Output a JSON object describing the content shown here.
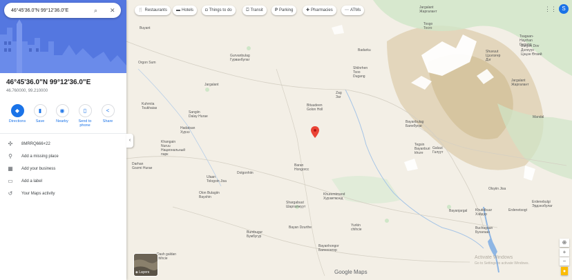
{
  "search": {
    "value": "46°45'36.0\"N 99°12'36.0\"E"
  },
  "place": {
    "title": "46°45'36.0\"N 99°12'36.0\"E",
    "coordinates": "46.760000, 99.210000"
  },
  "actions": [
    {
      "label": "Directions",
      "icon": "directions-icon"
    },
    {
      "label": "Save",
      "icon": "bookmark-icon"
    },
    {
      "label": "Nearby",
      "icon": "nearby-icon"
    },
    {
      "label": "Send to phone",
      "icon": "phone-icon"
    },
    {
      "label": "Share",
      "icon": "share-icon"
    }
  ],
  "info_rows": [
    {
      "text": "8MRRQ666+22",
      "icon": "plus-code-icon"
    },
    {
      "text": "Add a missing place",
      "icon": "add-place-icon"
    },
    {
      "text": "Add your business",
      "icon": "business-icon"
    },
    {
      "text": "Add a label",
      "icon": "label-icon"
    },
    {
      "text": "Your Maps activity",
      "icon": "history-icon"
    }
  ],
  "chips": [
    {
      "label": "Restaurants",
      "icon": "fork-knife-icon"
    },
    {
      "label": "Hotels",
      "icon": "bed-icon"
    },
    {
      "label": "Things to do",
      "icon": "camera-icon"
    },
    {
      "label": "Transit",
      "icon": "transit-icon"
    },
    {
      "label": "Parking",
      "icon": "parking-icon"
    },
    {
      "label": "Pharmacies",
      "icon": "pharmacy-icon"
    },
    {
      "label": "ATMs",
      "icon": "atm-icon"
    }
  ],
  "user_initial": "S",
  "layers_label": "Layers",
  "footer_brand": "Google Maps",
  "watermark": {
    "line1": "Activate Windows",
    "line2": "Go to Settings to activate Windows."
  },
  "map_labels": [
    {
      "text": "Buyant"
    },
    {
      "text": "Orgon Sum"
    },
    {
      "text": "Gurvanbulag\nГурванбулаг"
    },
    {
      "text": "Badarku"
    },
    {
      "text": "Jargalant\nЖаргалант"
    },
    {
      "text": "Tosgo\nТосго"
    },
    {
      "text": "Tsagaan-\nHayrhan\nDugang"
    },
    {
      "text": "Burgon Dov\nДэлхүүн\nЦэцэн Өлзий"
    },
    {
      "text": "Shuvuut\nЦээлэгер\nДэг"
    },
    {
      "text": "Shilnrhen\nTsoo\nDugang"
    },
    {
      "text": "Jargalant"
    },
    {
      "text": "Bituudeen\nGolon Holl"
    },
    {
      "text": "Zag\nЗаг"
    },
    {
      "text": "Jargalant\nЖаргалант"
    },
    {
      "text": "Kuhrniia\nTsukhaias"
    },
    {
      "text": "Sangiin\nDalay Hurae"
    },
    {
      "text": "Hadatsan\nХурээ"
    },
    {
      "text": "Bayanbulag\nБаянбулаг"
    },
    {
      "text": "Mandal"
    },
    {
      "text": "Khangain\nNuruu\nНациональный\nпарк"
    },
    {
      "text": "Tegsin\nBayanburi\nkhure"
    },
    {
      "text": "Galuut\nГалуут"
    },
    {
      "text": "Darhan\nGozmi Hurae"
    },
    {
      "text": "Baran\nHongorcc"
    },
    {
      "text": "Ulaan\nTologoin Jisa"
    },
    {
      "text": "Dolgonhiin"
    },
    {
      "text": "Olon Bulagiin\nBayshin"
    },
    {
      "text": "Khuremtmand\nХурэмтмэнд"
    },
    {
      "text": "Olsyiin Jisa"
    },
    {
      "text": "Erdenebulgi\nЭрдэнэбулаг"
    },
    {
      "text": "Shargabuut\nШаргалжуут"
    },
    {
      "text": "Bayanjargal"
    },
    {
      "text": "Khutidbuur\nXэйдэр"
    },
    {
      "text": "Erdenetsogt"
    },
    {
      "text": "Bayan Dzurthe"
    },
    {
      "text": "Yurkin\nchihcie"
    },
    {
      "text": "Bumbugur\nБумбугур"
    },
    {
      "text": "Buchagaan\nБухагаан"
    },
    {
      "text": "Bayanhongor\nБаянхонгор"
    },
    {
      "text": "Dash galdan\nchihcie"
    },
    {
      "text": "Jaaren Us"
    }
  ],
  "colors": {
    "pin": "#ea4335",
    "accent": "#1a73e8",
    "hero": "#5477e0",
    "land": "#f3efe6",
    "river": "#a5c4e6",
    "mountain": "#d8c9a8",
    "forest": "#c8e3c4"
  }
}
